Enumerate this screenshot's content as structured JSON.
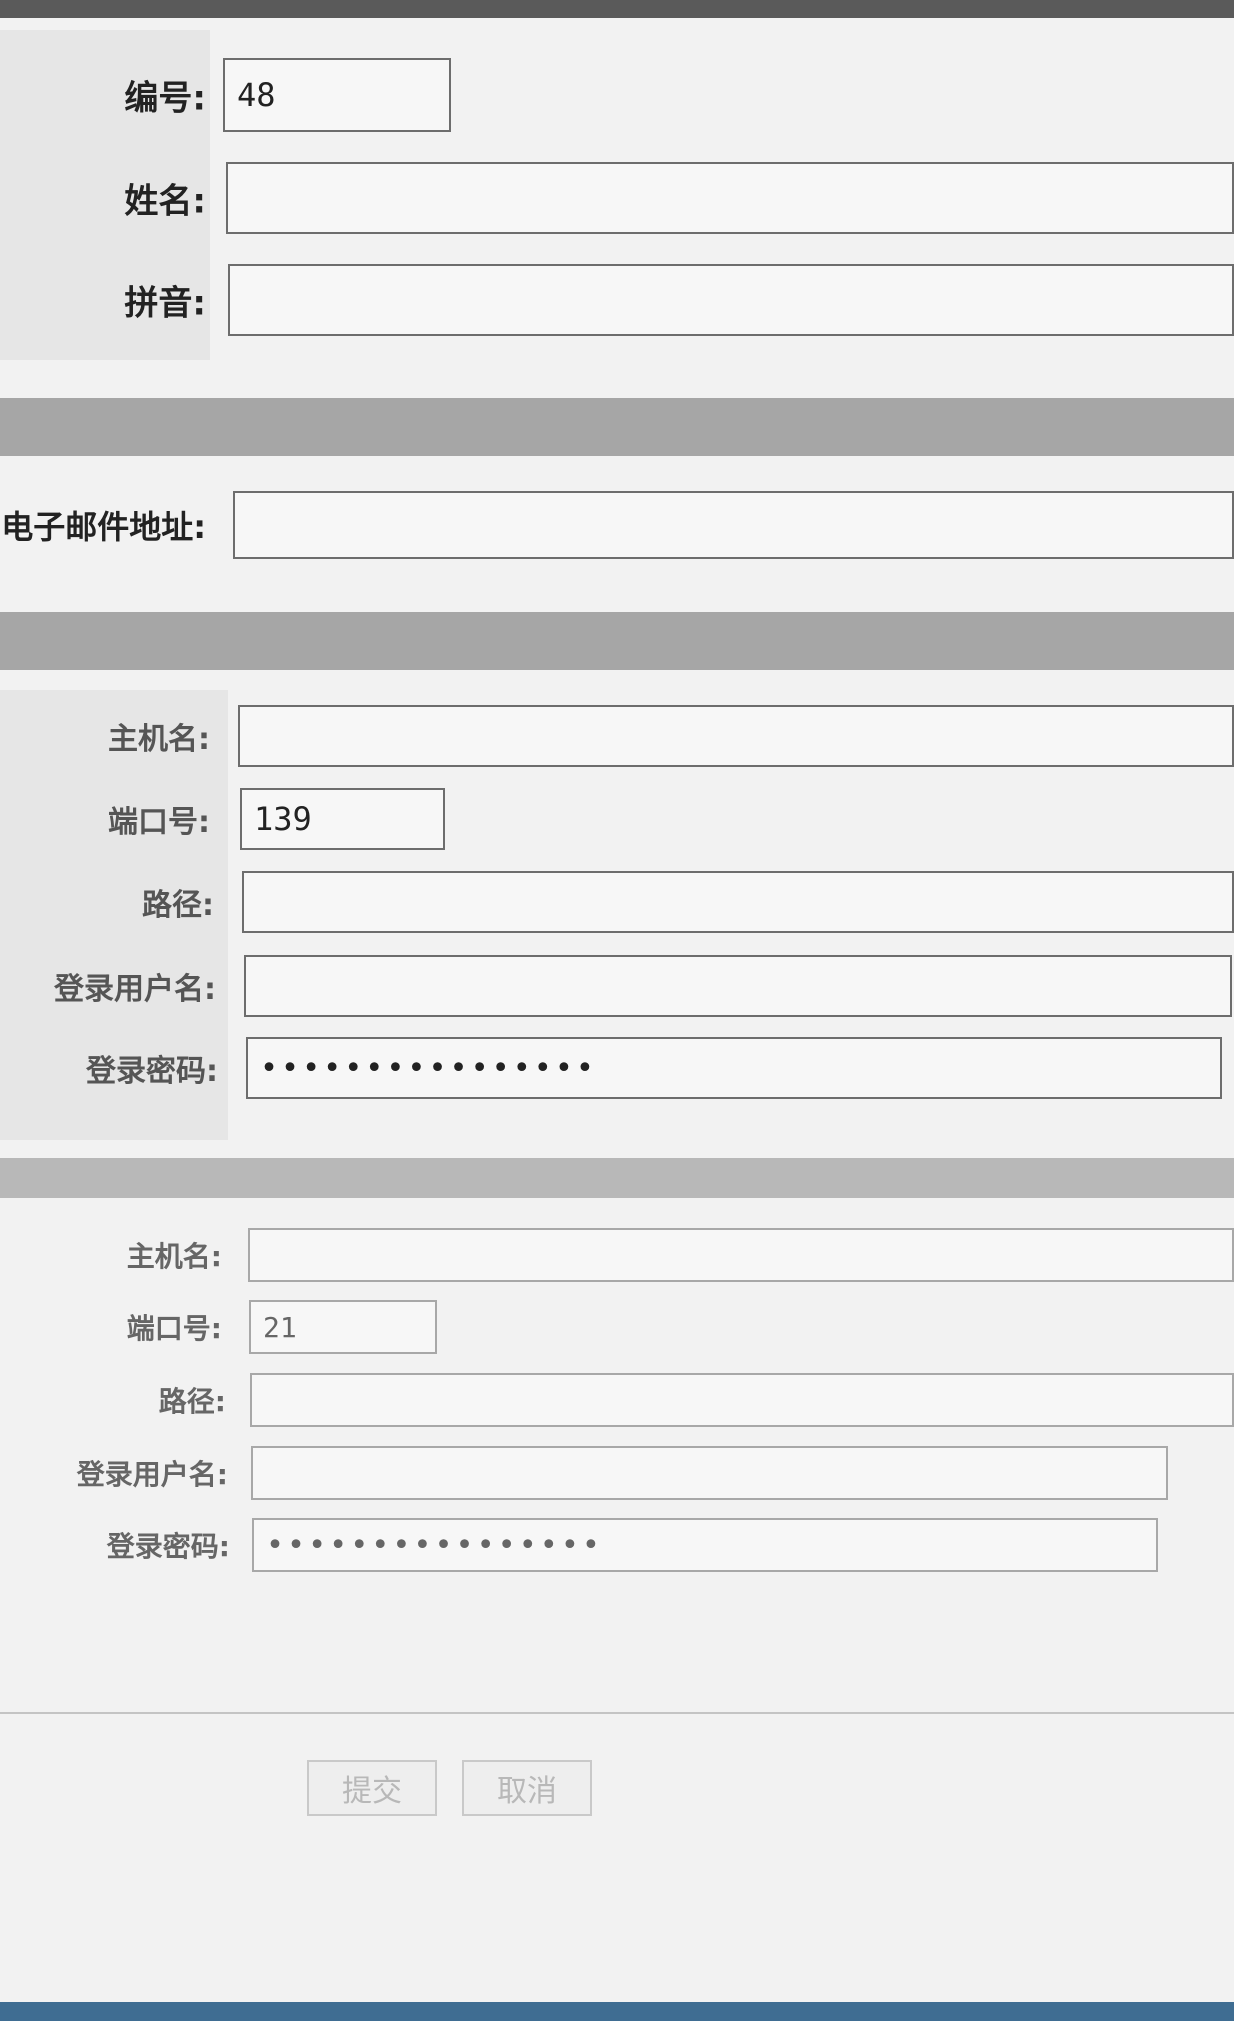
{
  "section1": {
    "fields": [
      {
        "label": "编号:",
        "value": "48"
      },
      {
        "label": "姓名:",
        "value": ""
      },
      {
        "label": "拼音:",
        "value": ""
      }
    ]
  },
  "section2": {
    "fields": [
      {
        "label": "电子邮件地址:",
        "value": ""
      }
    ]
  },
  "section3": {
    "fields": [
      {
        "label": "主机名:",
        "value": ""
      },
      {
        "label": "端口号:",
        "value": "139"
      },
      {
        "label": "路径:",
        "value": ""
      },
      {
        "label": "登录用户名:",
        "value": ""
      },
      {
        "label": "登录密码:",
        "value": "****************"
      }
    ]
  },
  "section4": {
    "fields": [
      {
        "label": "主机名:",
        "value": ""
      },
      {
        "label": "端口号:",
        "value": "21"
      },
      {
        "label": "路径:",
        "value": ""
      },
      {
        "label": "登录用户名:",
        "value": ""
      },
      {
        "label": "登录密码:",
        "value": "****************"
      }
    ]
  },
  "buttons": {
    "submit": "提交",
    "cancel": "取消"
  }
}
